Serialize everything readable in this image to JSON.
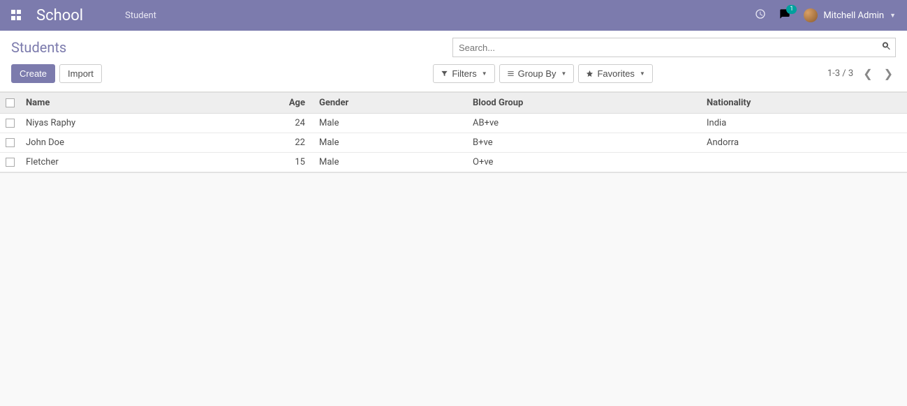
{
  "navbar": {
    "brand": "School",
    "menu": "Student",
    "user": "Mitchell Admin",
    "notifications": "1"
  },
  "controlPanel": {
    "title": "Students",
    "searchPlaceholder": "Search...",
    "createLabel": "Create",
    "importLabel": "Import",
    "filtersLabel": "Filters",
    "groupByLabel": "Group By",
    "favoritesLabel": "Favorites",
    "pager": "1-3 / 3"
  },
  "table": {
    "headers": {
      "name": "Name",
      "age": "Age",
      "gender": "Gender",
      "blood": "Blood Group",
      "nationality": "Nationality"
    },
    "rows": [
      {
        "name": "Niyas Raphy",
        "age": "24",
        "gender": "Male",
        "blood": "AB+ve",
        "nationality": "India"
      },
      {
        "name": "John Doe",
        "age": "22",
        "gender": "Male",
        "blood": "B+ve",
        "nationality": "Andorra"
      },
      {
        "name": "Fletcher",
        "age": "15",
        "gender": "Male",
        "blood": "O+ve",
        "nationality": ""
      }
    ]
  }
}
